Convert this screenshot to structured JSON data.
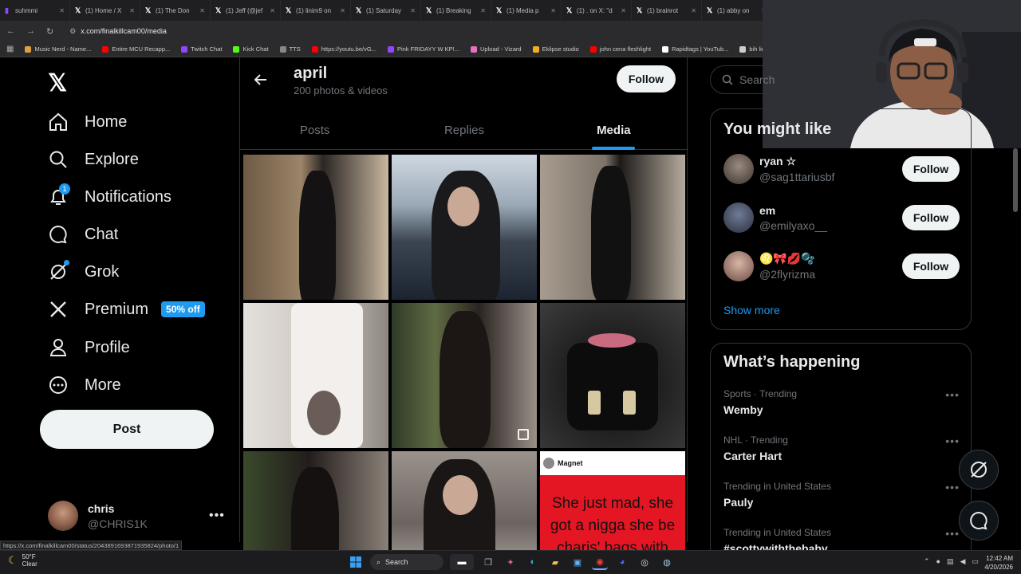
{
  "browser": {
    "tabs": [
      {
        "label": "suhmmi",
        "icon": "twitch-icon",
        "color": "#9146ff"
      },
      {
        "label": "(1) Home / X",
        "icon": "x-icon",
        "color": "#ffffff"
      },
      {
        "label": "(1) The Don",
        "icon": "x-icon",
        "color": "#ffffff"
      },
      {
        "label": "(1) Jeff (@jef",
        "icon": "x-icon",
        "color": "#ffffff"
      },
      {
        "label": "(1) linim9 on",
        "icon": "x-icon",
        "color": "#ffffff"
      },
      {
        "label": "(1) Saturday",
        "icon": "x-icon",
        "color": "#ffffff"
      },
      {
        "label": "(1) Breaking",
        "icon": "x-icon",
        "color": "#ffffff"
      },
      {
        "label": "(1) Media p",
        "icon": "x-icon",
        "color": "#ffffff"
      },
      {
        "label": "(1) . on X: \"d",
        "icon": "x-icon",
        "color": "#ffffff"
      },
      {
        "label": "(1) brainrot",
        "icon": "x-icon",
        "color": "#ffffff"
      },
      {
        "label": "(1) abby on",
        "icon": "x-icon",
        "color": "#ffffff"
      }
    ],
    "url": "x.com/finalkillcam00/media",
    "bookmarks": [
      {
        "label": "Music Nerd - Name...",
        "color": "#e0a040"
      },
      {
        "label": "Entire MCU Recapp...",
        "color": "#ff0000"
      },
      {
        "label": "Twitch Chat",
        "color": "#9146ff"
      },
      {
        "label": "Kick Chat",
        "color": "#53fc18"
      },
      {
        "label": "TTS",
        "color": "#888888"
      },
      {
        "label": "https://youtu.be/vG...",
        "color": "#ff0000"
      },
      {
        "label": "Pink FRIDAYY W KP!...",
        "color": "#9146ff"
      },
      {
        "label": "Upload - Vizard",
        "color": "#e870c0"
      },
      {
        "label": "Eklipse studio",
        "color": "#f0b020"
      },
      {
        "label": "john cena fleshlight",
        "color": "#ff0000"
      },
      {
        "label": "Rapidtags | YouTub...",
        "color": "#ffffff"
      },
      {
        "label": "bih links",
        "color": "#cccccc"
      }
    ],
    "status_url": "https://x.com/finalkillcam00/status/2043891693871935824/photo/1"
  },
  "leftnav": {
    "items": [
      {
        "label": "Home",
        "icon": "home-icon"
      },
      {
        "label": "Explore",
        "icon": "search-icon"
      },
      {
        "label": "Notifications",
        "icon": "bell-icon",
        "badge": "1"
      },
      {
        "label": "Chat",
        "icon": "chat-icon"
      },
      {
        "label": "Grok",
        "icon": "grok-icon"
      },
      {
        "label": "Premium",
        "icon": "x-icon",
        "pill": "50% off"
      },
      {
        "label": "Profile",
        "icon": "person-icon"
      },
      {
        "label": "More",
        "icon": "more-circle-icon"
      }
    ],
    "post_label": "Post",
    "account": {
      "name": "chris",
      "handle": "@CHRIS1K"
    }
  },
  "profile": {
    "name": "april",
    "subtitle": "200 photos & videos",
    "follow_label": "Follow",
    "tabs": [
      {
        "label": "Posts",
        "active": false
      },
      {
        "label": "Replies",
        "active": false
      },
      {
        "label": "Media",
        "active": true
      }
    ],
    "meme": {
      "author": "Magnet",
      "text": "She just mad, she got a nigga she be charis' bags with"
    }
  },
  "right": {
    "search_placeholder": "Search",
    "who_to_follow": {
      "title": "You might like",
      "users": [
        {
          "name": "ryan ☆",
          "handle": "@sag1ttariusbf",
          "follow": "Follow"
        },
        {
          "name": "em",
          "handle": "@emilyaxo__",
          "follow": "Follow"
        },
        {
          "name": "♌🎀💋🫧",
          "handle": "@2flyrizma",
          "follow": "Follow"
        }
      ],
      "show_more": "Show more"
    },
    "happening": {
      "title": "What’s happening",
      "trends": [
        {
          "context": "Sports · Trending",
          "name": "Wemby"
        },
        {
          "context": "NHL · Trending",
          "name": "Carter Hart"
        },
        {
          "context": "Trending in United States",
          "name": "Pauly"
        },
        {
          "context": "Trending in United States",
          "name": "#scottywiththebaby"
        }
      ]
    }
  },
  "taskbar": {
    "weather_temp": "50°F",
    "weather_desc": "Clear",
    "search_label": "Search",
    "time": "12:42 AM",
    "date": "4/20/2026"
  },
  "colors": {
    "accent": "#1d9bf0",
    "background": "#000000",
    "border": "#2f3336",
    "muted": "#71767b"
  }
}
